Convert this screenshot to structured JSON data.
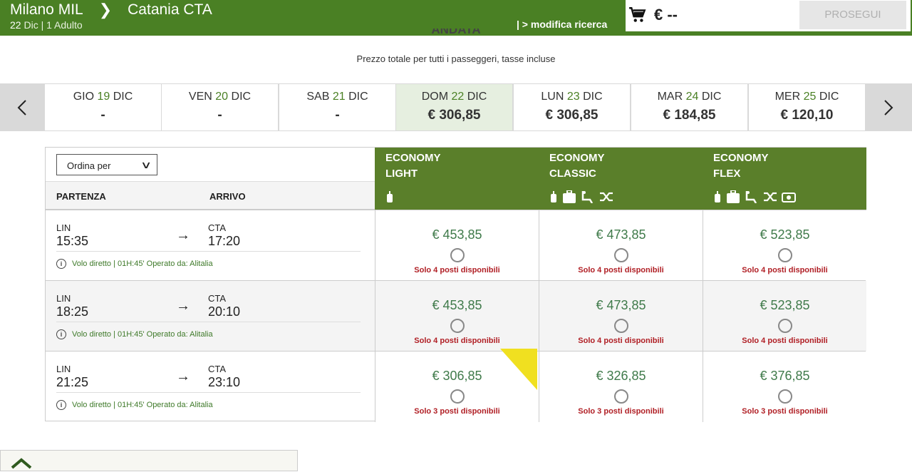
{
  "header": {
    "origin": "Milano MIL",
    "destination": "Catania CTA",
    "date_num": "22",
    "date_rest": "Dic | 1 Adulto",
    "modifica": "| > modifica ricerca",
    "cart_price": "€ --",
    "prosegui": "PROSEGUI"
  },
  "section": {
    "title": "ANDATA",
    "note": "Prezzo totale per tutti i passeggeri, tasse incluse"
  },
  "dates": [
    {
      "dow": "GIO",
      "num": "19",
      "mon": "DIC",
      "price": "-"
    },
    {
      "dow": "VEN",
      "num": "20",
      "mon": "DIC",
      "price": "-"
    },
    {
      "dow": "SAB",
      "num": "21",
      "mon": "DIC",
      "price": "-"
    },
    {
      "dow": "DOM",
      "num": "22",
      "mon": "DIC",
      "price": "€ 306,85"
    },
    {
      "dow": "LUN",
      "num": "23",
      "mon": "DIC",
      "price": "€ 306,85"
    },
    {
      "dow": "MAR",
      "num": "24",
      "mon": "DIC",
      "price": "€ 184,85"
    },
    {
      "dow": "MER",
      "num": "25",
      "mon": "DIC",
      "price": "€ 120,10"
    }
  ],
  "table": {
    "ordina": "Ordina per",
    "partenza": "PARTENZA",
    "arrivo": "ARRIVO",
    "fares": [
      {
        "line1": "ECONOMY",
        "line2": "LIGHT"
      },
      {
        "line1": "ECONOMY",
        "line2": "CLASSIC"
      },
      {
        "line1": "ECONOMY",
        "line2": "FLEX"
      }
    ],
    "flights": [
      {
        "from_code": "LIN",
        "from_time": "15:35",
        "to_code": "CTA",
        "to_time": "17:20",
        "info": "Volo diretto | 01H:45' Operato da: Alitalia",
        "prices": [
          "€ 453,85",
          "€ 473,85",
          "€ 523,85"
        ],
        "seats": [
          "Solo 4 posti disponibili",
          "Solo 4 posti disponibili",
          "Solo 4 posti disponibili"
        ]
      },
      {
        "from_code": "LIN",
        "from_time": "18:25",
        "to_code": "CTA",
        "to_time": "20:10",
        "info": "Volo diretto | 01H:45' Operato da: Alitalia",
        "prices": [
          "€ 453,85",
          "€ 473,85",
          "€ 523,85"
        ],
        "seats": [
          "Solo 4 posti disponibili",
          "Solo 4 posti disponibili",
          "Solo 4 posti disponibili"
        ]
      },
      {
        "from_code": "LIN",
        "from_time": "21:25",
        "to_code": "CTA",
        "to_time": "23:10",
        "info": "Volo diretto | 01H:45' Operato da: Alitalia",
        "prices": [
          "€ 306,85",
          "€ 326,85",
          "€ 376,85"
        ],
        "seats": [
          "Solo 3 posti disponibili",
          "Solo 3 posti disponibili",
          "Solo 3 posti disponibili"
        ]
      }
    ]
  },
  "colors": {
    "brand_green": "#4a8024",
    "fare_green": "#5a7f2a",
    "alert_red": "#b01e24",
    "ribbon": "#f0e020"
  }
}
